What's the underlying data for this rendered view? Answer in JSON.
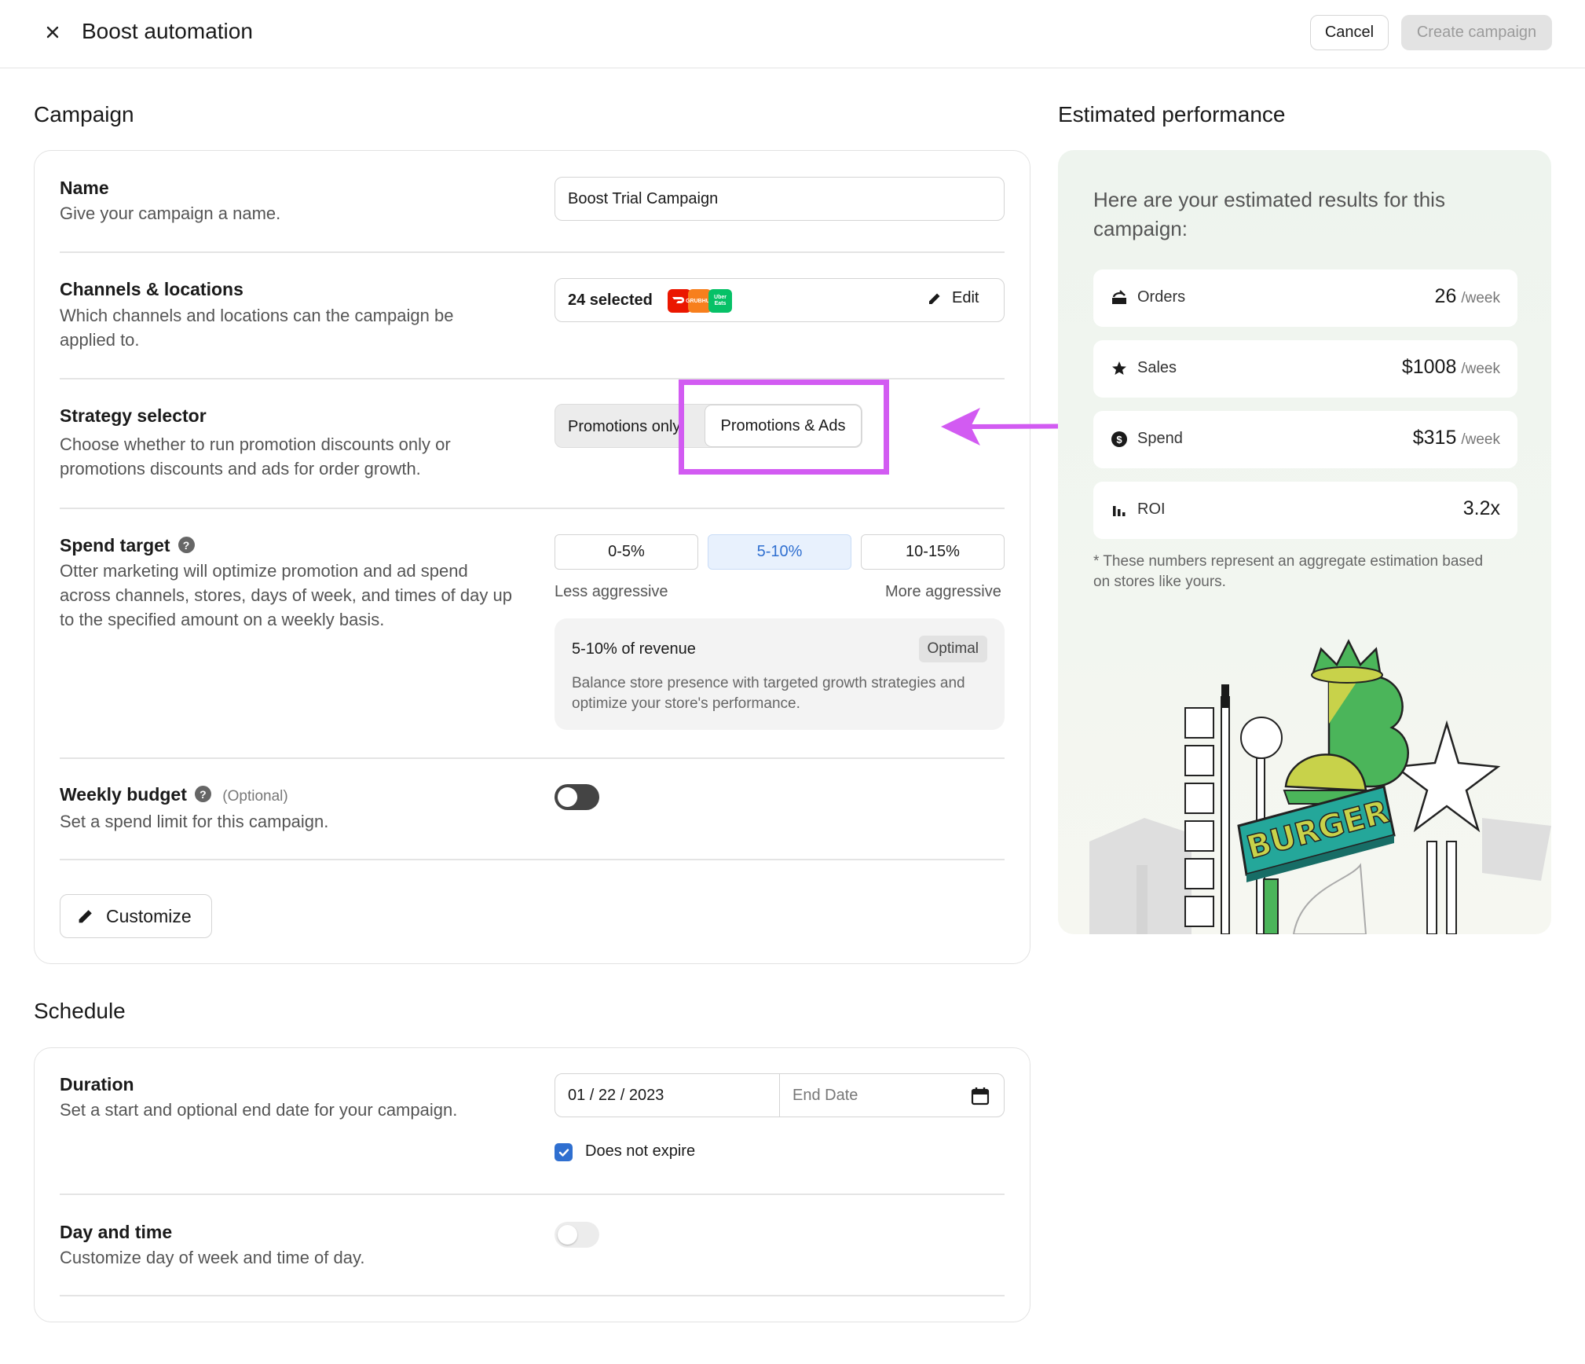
{
  "header": {
    "title": "Boost automation",
    "cancel_label": "Cancel",
    "create_label": "Create campaign"
  },
  "campaign": {
    "heading": "Campaign",
    "name": {
      "label": "Name",
      "description": "Give your campaign a name.",
      "value": "Boost Trial Campaign"
    },
    "channels": {
      "label": "Channels & locations",
      "description": "Which channels and locations can the campaign be applied to.",
      "selected": "24 selected",
      "edit_label": "Edit",
      "logos": [
        {
          "name": "doordash-logo",
          "text": "",
          "color": "#eb1700"
        },
        {
          "name": "grubhub-logo",
          "text": "GRUBHUB",
          "color": "#f77f1d"
        },
        {
          "name": "ubereats-logo",
          "text": "Uber Eats",
          "color": "#06c167"
        }
      ]
    },
    "strategy": {
      "label": "Strategy selector",
      "description": "Choose whether to run promotion discounts only or promotions discounts and ads for order growth.",
      "option_left": "Promotions only",
      "option_right": "Promotions & Ads"
    },
    "spend": {
      "label": "Spend target",
      "description": "Otter marketing will optimize promotion and ad spend across channels, stores, days of week, and times of day up to the specified amount on a weekly basis.",
      "options": [
        "0-5%",
        "5-10%",
        "10-15%"
      ],
      "less": "Less aggressive",
      "more": "More aggressive",
      "info_title": "5-10% of revenue",
      "info_badge": "Optimal",
      "info_text": "Balance store presence with targeted growth strategies and optimize your store's performance."
    },
    "budget": {
      "label": "Weekly budget",
      "optional": "(Optional)",
      "description": "Set a spend limit for this campaign."
    },
    "customize_label": "Customize"
  },
  "schedule": {
    "heading": "Schedule",
    "duration": {
      "label": "Duration",
      "description": "Set a start and optional end date for your campaign.",
      "start": "01 / 22 / 2023",
      "end_placeholder": "End Date",
      "no_expire": "Does not expire"
    },
    "daytime": {
      "label": "Day and time",
      "description": "Customize day of week and time of day."
    }
  },
  "performance": {
    "heading": "Estimated performance",
    "intro": "Here are your estimated results for this campaign:",
    "metrics": [
      {
        "icon": "orders-icon",
        "label": "Orders",
        "value": "26",
        "unit": "/week"
      },
      {
        "icon": "star-icon",
        "label": "Sales",
        "value": "$1008",
        "unit": "/week"
      },
      {
        "icon": "dollar-icon",
        "label": "Spend",
        "value": "$315",
        "unit": "/week"
      },
      {
        "icon": "bar-chart-icon",
        "label": "ROI",
        "value": "3.2x",
        "unit": ""
      }
    ],
    "footnote": "* These numbers represent an aggregate estimation based on stores like yours.",
    "sign_text": "BURGER"
  },
  "colors": {
    "accent_blue": "#2f6fd0",
    "highlight": "#d25bf2",
    "brand_green": "#4bb55a",
    "sign_teal": "#24a79a",
    "sign_yellow": "#c8d24a"
  }
}
